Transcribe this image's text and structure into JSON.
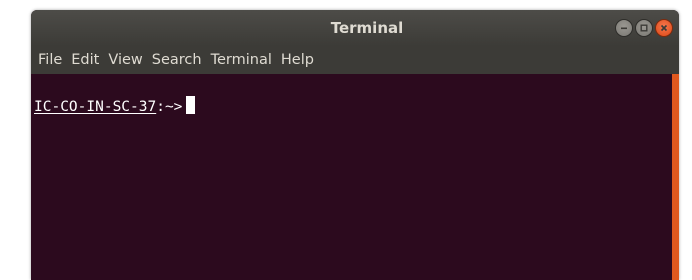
{
  "window": {
    "title": "Terminal",
    "controls": [
      "minimize-icon",
      "maximize-icon",
      "close-icon"
    ]
  },
  "menu": {
    "items": [
      {
        "label": "File"
      },
      {
        "label": "Edit"
      },
      {
        "label": "View"
      },
      {
        "label": "Search"
      },
      {
        "label": "Terminal"
      },
      {
        "label": "Help"
      }
    ]
  },
  "terminal": {
    "host": "IC-CO-IN-SC-37",
    "prompt_suffix": ":~>",
    "background": "#2c0a1e",
    "text_color": "#ffffff"
  },
  "colors": {
    "accent": "#e0581e",
    "titlebar": "#3c3b37"
  }
}
